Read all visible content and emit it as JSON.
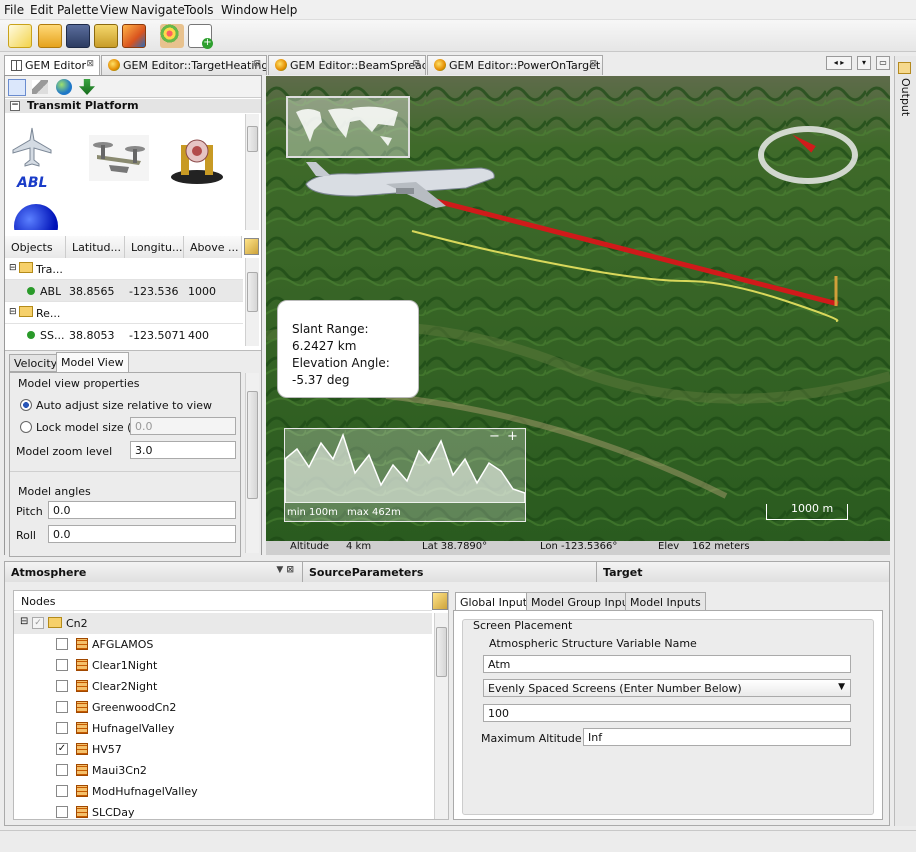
{
  "menu": [
    "File",
    "Edit",
    "Palette",
    "View",
    "Navigate",
    "Tools",
    "Window",
    "Help"
  ],
  "toolbar": [
    "new-file-icon",
    "open-folder-icon",
    "save-icon",
    "save-all-icon",
    "matlab-icon",
    "palette-icon",
    "new-window-icon"
  ],
  "tabs": [
    {
      "label": "GEM Editor"
    },
    {
      "label": "GEM Editor::TargetHeating"
    },
    {
      "label": "GEM Editor::BeamSpread"
    },
    {
      "label": "GEM Editor::PowerOnTarget"
    }
  ],
  "output_label": "Output",
  "palette": {
    "title": "Transmit Platform",
    "abl_label": "ABL"
  },
  "objects": {
    "headers": [
      "Objects",
      "Latitud...",
      "Longitu...",
      "Above ..."
    ],
    "rows": [
      {
        "name": "Tra...",
        "lat": "",
        "lon": "",
        "alt": "",
        "group": true
      },
      {
        "name": "ABL",
        "lat": "38.8565",
        "lon": "-123.536",
        "alt": "1000",
        "group": false
      },
      {
        "name": "Re...",
        "lat": "",
        "lon": "",
        "alt": "",
        "group": true
      },
      {
        "name": "SS...",
        "lat": "38.8053",
        "lon": "-123.5071",
        "alt": "400",
        "group": false
      }
    ]
  },
  "props": {
    "tabs": [
      "Velocity",
      "Model View"
    ],
    "group1": "Model view properties",
    "radio1": "Auto adjust size relative to view",
    "radio2": "Lock model size (m)",
    "lock_value": "0.0",
    "zoom_label": "Model zoom level",
    "zoom_value": "3.0",
    "group2": "Model angles",
    "pitch_label": "Pitch",
    "pitch_value": "0.0",
    "roll_label": "Roll",
    "roll_value": "0.0"
  },
  "map": {
    "info": "Slant Range: 6.2427 km Elevation Angle: -5.37 deg",
    "profile_min": "min 100m",
    "profile_max": "max 462m",
    "scale": "1000 m"
  },
  "status": {
    "altitude_label": "Altitude",
    "altitude": "4 km",
    "lat": "Lat  38.7890°",
    "lon": "Lon -123.5366°",
    "elev_label": "Elev",
    "elev": "162 meters"
  },
  "panels": {
    "atmosphere": "Atmosphere",
    "source": "SourceParameters",
    "target": "Target"
  },
  "tree": {
    "header": "Nodes",
    "root": "Cn2",
    "nodes": [
      {
        "label": "AFGLAMOS",
        "checked": ""
      },
      {
        "label": "Clear1Night",
        "checked": ""
      },
      {
        "label": "Clear2Night",
        "checked": ""
      },
      {
        "label": "GreenwoodCn2",
        "checked": ""
      },
      {
        "label": "HufnagelValley",
        "checked": ""
      },
      {
        "label": "HV57",
        "checked": "✓"
      },
      {
        "label": "Maui3Cn2",
        "checked": ""
      },
      {
        "label": "ModHufnagelValley",
        "checked": ""
      },
      {
        "label": "SLCDay",
        "checked": ""
      }
    ]
  },
  "inputs": {
    "tabs": [
      "Global Inputs",
      "Model Group Inputs",
      "Model Inputs"
    ],
    "group": "Screen Placement",
    "var_label": "Atmospheric Structure Variable Name",
    "var_value": "Atm",
    "select_value": "Evenly Spaced Screens (Enter Number Below)",
    "count_value": "100",
    "maxalt_label": "Maximum Altitude (m)",
    "maxalt_value": "Inf"
  }
}
